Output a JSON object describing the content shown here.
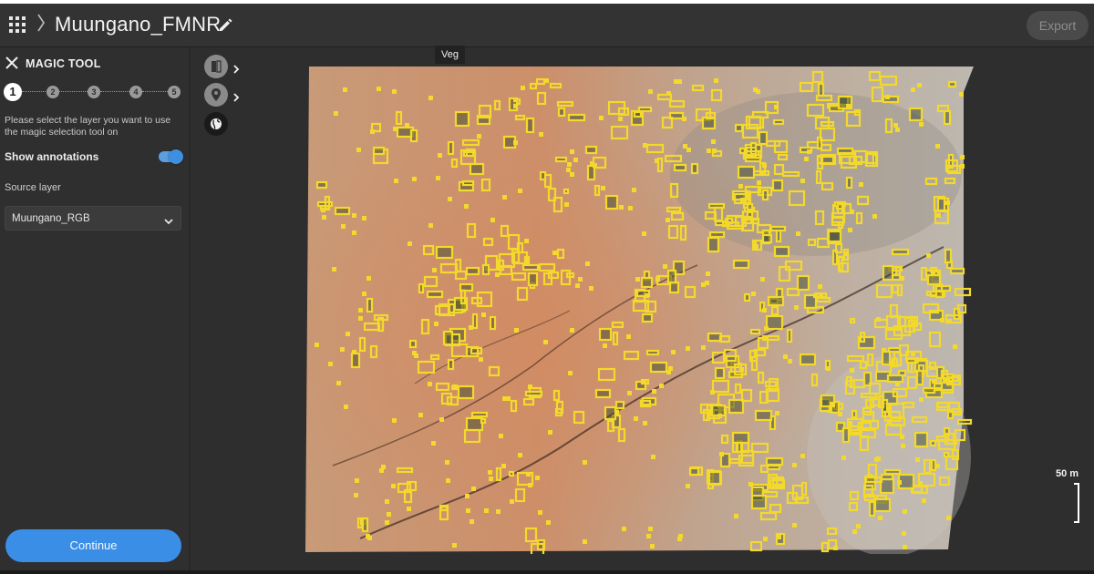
{
  "header": {
    "apps_icon": "apps-grid-icon",
    "breadcrumb_icon": "chevron-right-icon",
    "project_name": "Muungano_FMNR",
    "edit_icon": "pencil-icon",
    "export_label": "Export"
  },
  "sidebar": {
    "close_icon": "close-icon",
    "title": "MAGIC TOOL",
    "steps": [
      "1",
      "2",
      "3",
      "4",
      "5"
    ],
    "active_step": 1,
    "instruction": "Please select the layer you want to use the magic selection tool on",
    "show_annotations_label": "Show annotations",
    "show_annotations_on": true,
    "source_layer_label": "Source layer",
    "source_layer_value": "Muungano_RGB",
    "continue_label": "Continue"
  },
  "map": {
    "layer_buttons": [
      "layers-compare-icon",
      "location-pin-icon",
      "globe-icon"
    ],
    "tooltip": "Veg",
    "scale_label": "50 m",
    "annotation_color": "#f3d92c",
    "accent_color": "#3a8ee6"
  }
}
